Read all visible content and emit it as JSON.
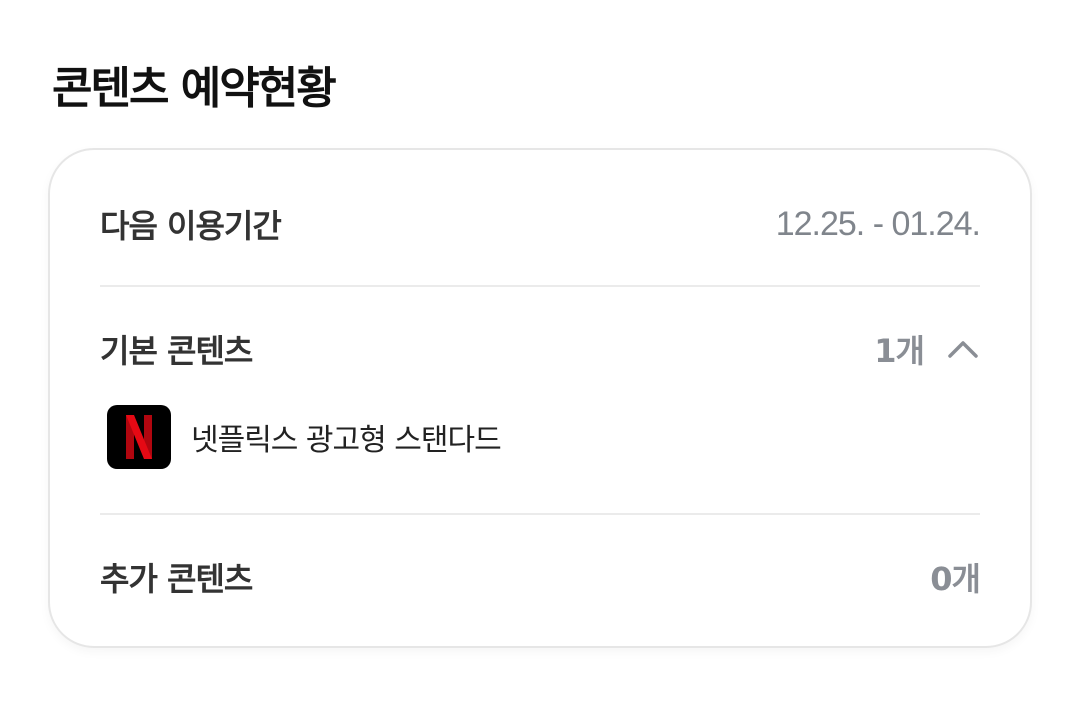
{
  "header": {
    "title": "콘텐츠 예약현황"
  },
  "card": {
    "period": {
      "label": "다음 이용기간",
      "value": "12.25. - 01.24."
    },
    "basic_content": {
      "label": "기본 콘텐츠",
      "count": "1개",
      "expanded": true,
      "items": [
        {
          "name": "넷플릭스 광고형 스탠다드",
          "icon": "netflix-logo-icon",
          "icon_letter": "N",
          "brand_color": "#e50914"
        }
      ]
    },
    "extra_content": {
      "label": "추가 콘텐츠",
      "count": "0개"
    }
  },
  "colors": {
    "title": "#111111",
    "label": "#333333",
    "muted": "#80858c",
    "divider": "#ebebeb",
    "card_border": "#e6e6e6"
  }
}
